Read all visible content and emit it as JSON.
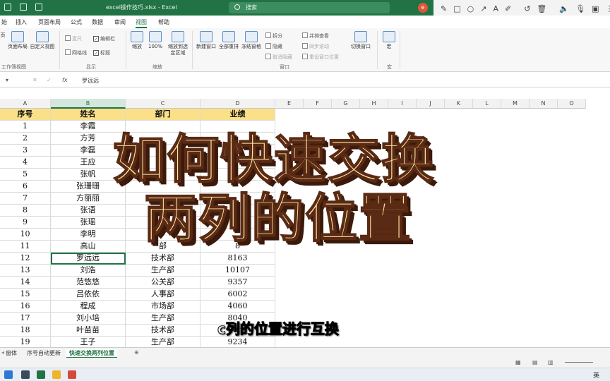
{
  "window": {
    "doc_title": "excel操作技巧.xlsx - Excel",
    "search_placeholder": "搜索",
    "account_initial": "e"
  },
  "annotation_toolbar": {
    "icons": [
      "pen-icon",
      "square-icon",
      "circle-icon",
      "arrow-icon",
      "text-icon",
      "highlighter-icon",
      "undo-icon",
      "trash-icon",
      "speaker-icon",
      "mic-icon",
      "camera-icon",
      "more-icon"
    ]
  },
  "menu": {
    "items": [
      "始",
      "插入",
      "页面布局",
      "公式",
      "数据",
      "审阅",
      "视图",
      "帮助"
    ],
    "active_index": 6
  },
  "ribbon": {
    "views": {
      "normal_sub": "页",
      "pagelayout": "页面布局",
      "custom": "自定义视图",
      "group_label": "工作簿视图"
    },
    "show": {
      "ruler": "直尺",
      "gridlines": "网格线",
      "formula_bar": "编辑栏",
      "headings": "标题",
      "group_label": "显示"
    },
    "zoom": {
      "zoom": "缩放",
      "z100": "100%",
      "to_selection": "缩放到选定区域",
      "group_label": "缩放"
    },
    "window": {
      "new": "新建窗口",
      "arrange": "全部重排",
      "freeze": "冻结窗格",
      "split": "拆分",
      "hide": "隐藏",
      "unhide": "取消隐藏",
      "side_by_side": "并排查看",
      "sync_scroll": "同步滚动",
      "reset_pos": "重设窗口位置",
      "switch": "切换窗口",
      "group_label": "窗口"
    },
    "macros": {
      "macro": "宏",
      "group_label": "宏"
    }
  },
  "formula_bar": {
    "name_box": "",
    "value": "罗远远"
  },
  "columns": [
    "A",
    "B",
    "C",
    "D",
    "E",
    "F",
    "G",
    "H",
    "I",
    "J",
    "K",
    "L",
    "M",
    "N",
    "O"
  ],
  "table": {
    "headers": [
      "序号",
      "姓名",
      "部门",
      "业绩"
    ],
    "rows": [
      [
        "1",
        "李霞",
        "",
        ""
      ],
      [
        "2",
        "方芳",
        "",
        ""
      ],
      [
        "3",
        "李磊",
        "",
        ""
      ],
      [
        "4",
        "王应",
        "",
        ""
      ],
      [
        "5",
        "张帆",
        "",
        ""
      ],
      [
        "6",
        "张珊珊",
        "",
        ""
      ],
      [
        "7",
        "方丽丽",
        "",
        ""
      ],
      [
        "8",
        "张语",
        "",
        ""
      ],
      [
        "9",
        "张瑶",
        "",
        ""
      ],
      [
        "10",
        "李明",
        "",
        ""
      ],
      [
        "11",
        "高山",
        "部",
        "8"
      ],
      [
        "12",
        "罗远远",
        "技术部",
        "8163"
      ],
      [
        "13",
        "刘浩",
        "生产部",
        "10107"
      ],
      [
        "14",
        "范悠悠",
        "公关部",
        "9357"
      ],
      [
        "15",
        "吕依依",
        "人事部",
        "6002"
      ],
      [
        "16",
        "程成",
        "市场部",
        "4060"
      ],
      [
        "17",
        "刘小培",
        "生产部",
        "8040"
      ],
      [
        "18",
        "叶苗苗",
        "技术部",
        "8060"
      ],
      [
        "19",
        "王子",
        "生产部",
        "9234"
      ]
    ],
    "selected_row_index": 11
  },
  "sheet_tabs": {
    "items": [
      "窗体",
      "序号自动更新",
      "快速交换两列位置"
    ],
    "active_index": 2
  },
  "overlay": {
    "title_line1": "如何快速交换",
    "title_line2": "两列的位置",
    "subtitle": "c列的位置进行互换"
  },
  "taskbar": {
    "ime": "英"
  }
}
